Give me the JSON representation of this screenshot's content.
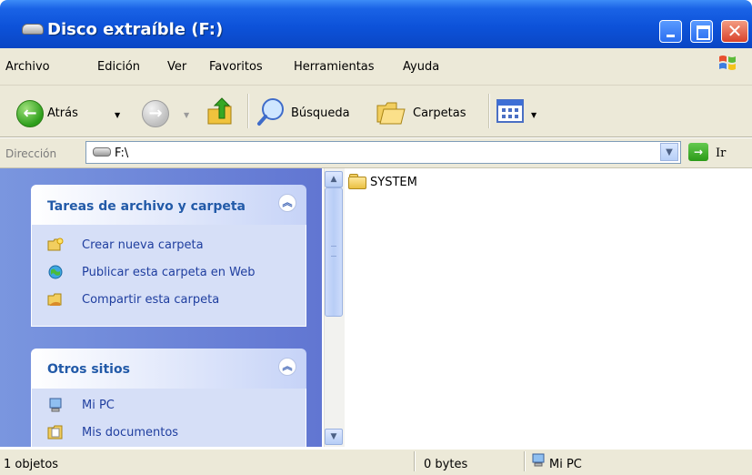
{
  "window": {
    "title": "Disco extraíble (F:)",
    "accent": "#0a46c4"
  },
  "menu": [
    "Archivo",
    "Edición",
    "Ver",
    "Favoritos",
    "Herramientas",
    "Ayuda"
  ],
  "toolbar": {
    "back_label": "Atrás",
    "search_label": "Búsqueda",
    "folders_label": "Carpetas"
  },
  "address": {
    "label": "Dirección",
    "value": "F:\\",
    "go_label": "Ir"
  },
  "taskpane": {
    "file_tasks": {
      "title": "Tareas de archivo y carpeta",
      "items": [
        "Crear nueva carpeta",
        "Publicar esta carpeta en Web",
        "Compartir esta carpeta"
      ]
    },
    "other_places": {
      "title": "Otros sitios",
      "items": [
        "Mi PC",
        "Mis documentos"
      ]
    }
  },
  "files": [
    {
      "name": "SYSTEM",
      "icon": "folder-icon"
    }
  ],
  "status": {
    "objects": "1 objetos",
    "size": "0 bytes",
    "location": "Mi PC"
  },
  "icons": [
    "removable-drive-icon",
    "minimize-icon",
    "maximize-icon",
    "close-icon",
    "windows-logo-icon",
    "back-arrow-icon",
    "forward-arrow-icon",
    "up-folder-icon",
    "search-icon",
    "folders-icon",
    "views-icon",
    "go-arrow-icon",
    "collapse-icon",
    "new-folder-icon",
    "publish-web-icon",
    "share-folder-icon",
    "computer-icon",
    "documents-icon"
  ]
}
